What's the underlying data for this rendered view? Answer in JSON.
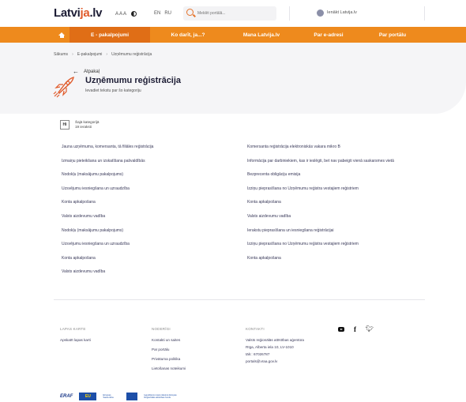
{
  "header": {
    "logo_main": "Latvi",
    "logo_accent": "ja",
    "logo_end": ".lv",
    "font_tools": "A A A",
    "languages": [
      "EN",
      "RU"
    ],
    "search_placeholder": "Meklēt portālā...",
    "login_label": "Ienākt Latvija.lv"
  },
  "nav": {
    "items": [
      "E - pakalpojumi",
      "Ko darīt, ja...?",
      "Mana Latvija.lv",
      "Par e-adresi",
      "Par portālu"
    ],
    "active": "E - pakalpojumi"
  },
  "breadcrumb": [
    "Sākums",
    "E-pakalpojumi",
    "Uzņēmumu reģistrācija"
  ],
  "page": {
    "back_label": "Atpakaļ",
    "title": "Uzņēmumu reģistrācija",
    "subtitle": "Ievadiet tekstu par šo kategoriju"
  },
  "category": {
    "badge": "Hi",
    "name": "Šajā kategorijā",
    "count": "19 ieraksti"
  },
  "links_left": [
    "Jauna uzņēmuma, komersanta, tā filiāles reģistrācija",
    "Izmaiņu pieteikšana un izskatīšana pašvaldībās",
    "Nodokļu (maksājumu pakalpojums)",
    "Uzsvējumu iesniegšana un uzraudzība",
    "Konta apkalpošana",
    "Valsts aizdevumu vadība",
    "Nodokļu (maksājumu pakalpojums)",
    "Uzsvējumu iesniegšana un uzraudzība",
    "Konta apkalpošana",
    "Valsts aizdevumu vadība"
  ],
  "links_right": [
    "Komersanta reģistrācija elektroniskās vakara mikro B",
    "Informācija par darbiniekiem, kas ir ieslēgti, bet nav pabeigti vienā saskarsmes vietā",
    "Bezprecenta obligāciju emisija",
    "Izziņu pieprasīšana no Uzņēmumu reģistra vestajiem reģistriem",
    "Konta apkalpošana",
    "Valsts aizdevumu vadība",
    "Ierakstu pieprasīšana un iesniegšana reģistrācijai",
    "Izziņu pieprasīšana no Uzņēmumu reģistra vestajiem reģistriem",
    "Konta apkalpošana"
  ],
  "footer": {
    "col1_head": "LAPAS KARTE",
    "col1_links": [
      "Apskatīt lapas karti"
    ],
    "col2_head": "NODERĪGI",
    "col2_links": [
      "Kontakti un saites",
      "Par portālu",
      "Privātuma politika",
      "Lietošanas noteikumi"
    ],
    "col3_head": "KONTAKTI",
    "col3_lines": [
      "Valsts reģionālās attīstības aģentūra",
      "Rīga, Alberta iela 10, LV-1010",
      "tālr.: 67026787",
      "portals@vraa.gov.lv"
    ],
    "social_icons": [
      "youtube-icon",
      "facebook-icon",
      "twitter-icon"
    ],
    "logos": {
      "eraf": "ERAF",
      "eu": "EU",
      "eu_text": "Eiropas Savienība",
      "fund_text": "Ieguldījums tavā nākotnē Eiropas Reģionālās attīstības fonds"
    }
  },
  "colors": {
    "nav_orange": "#ee8a1d",
    "nav_active": "#e06e16",
    "accent_red": "#e05a2a",
    "text_dark": "#1d1d35"
  }
}
